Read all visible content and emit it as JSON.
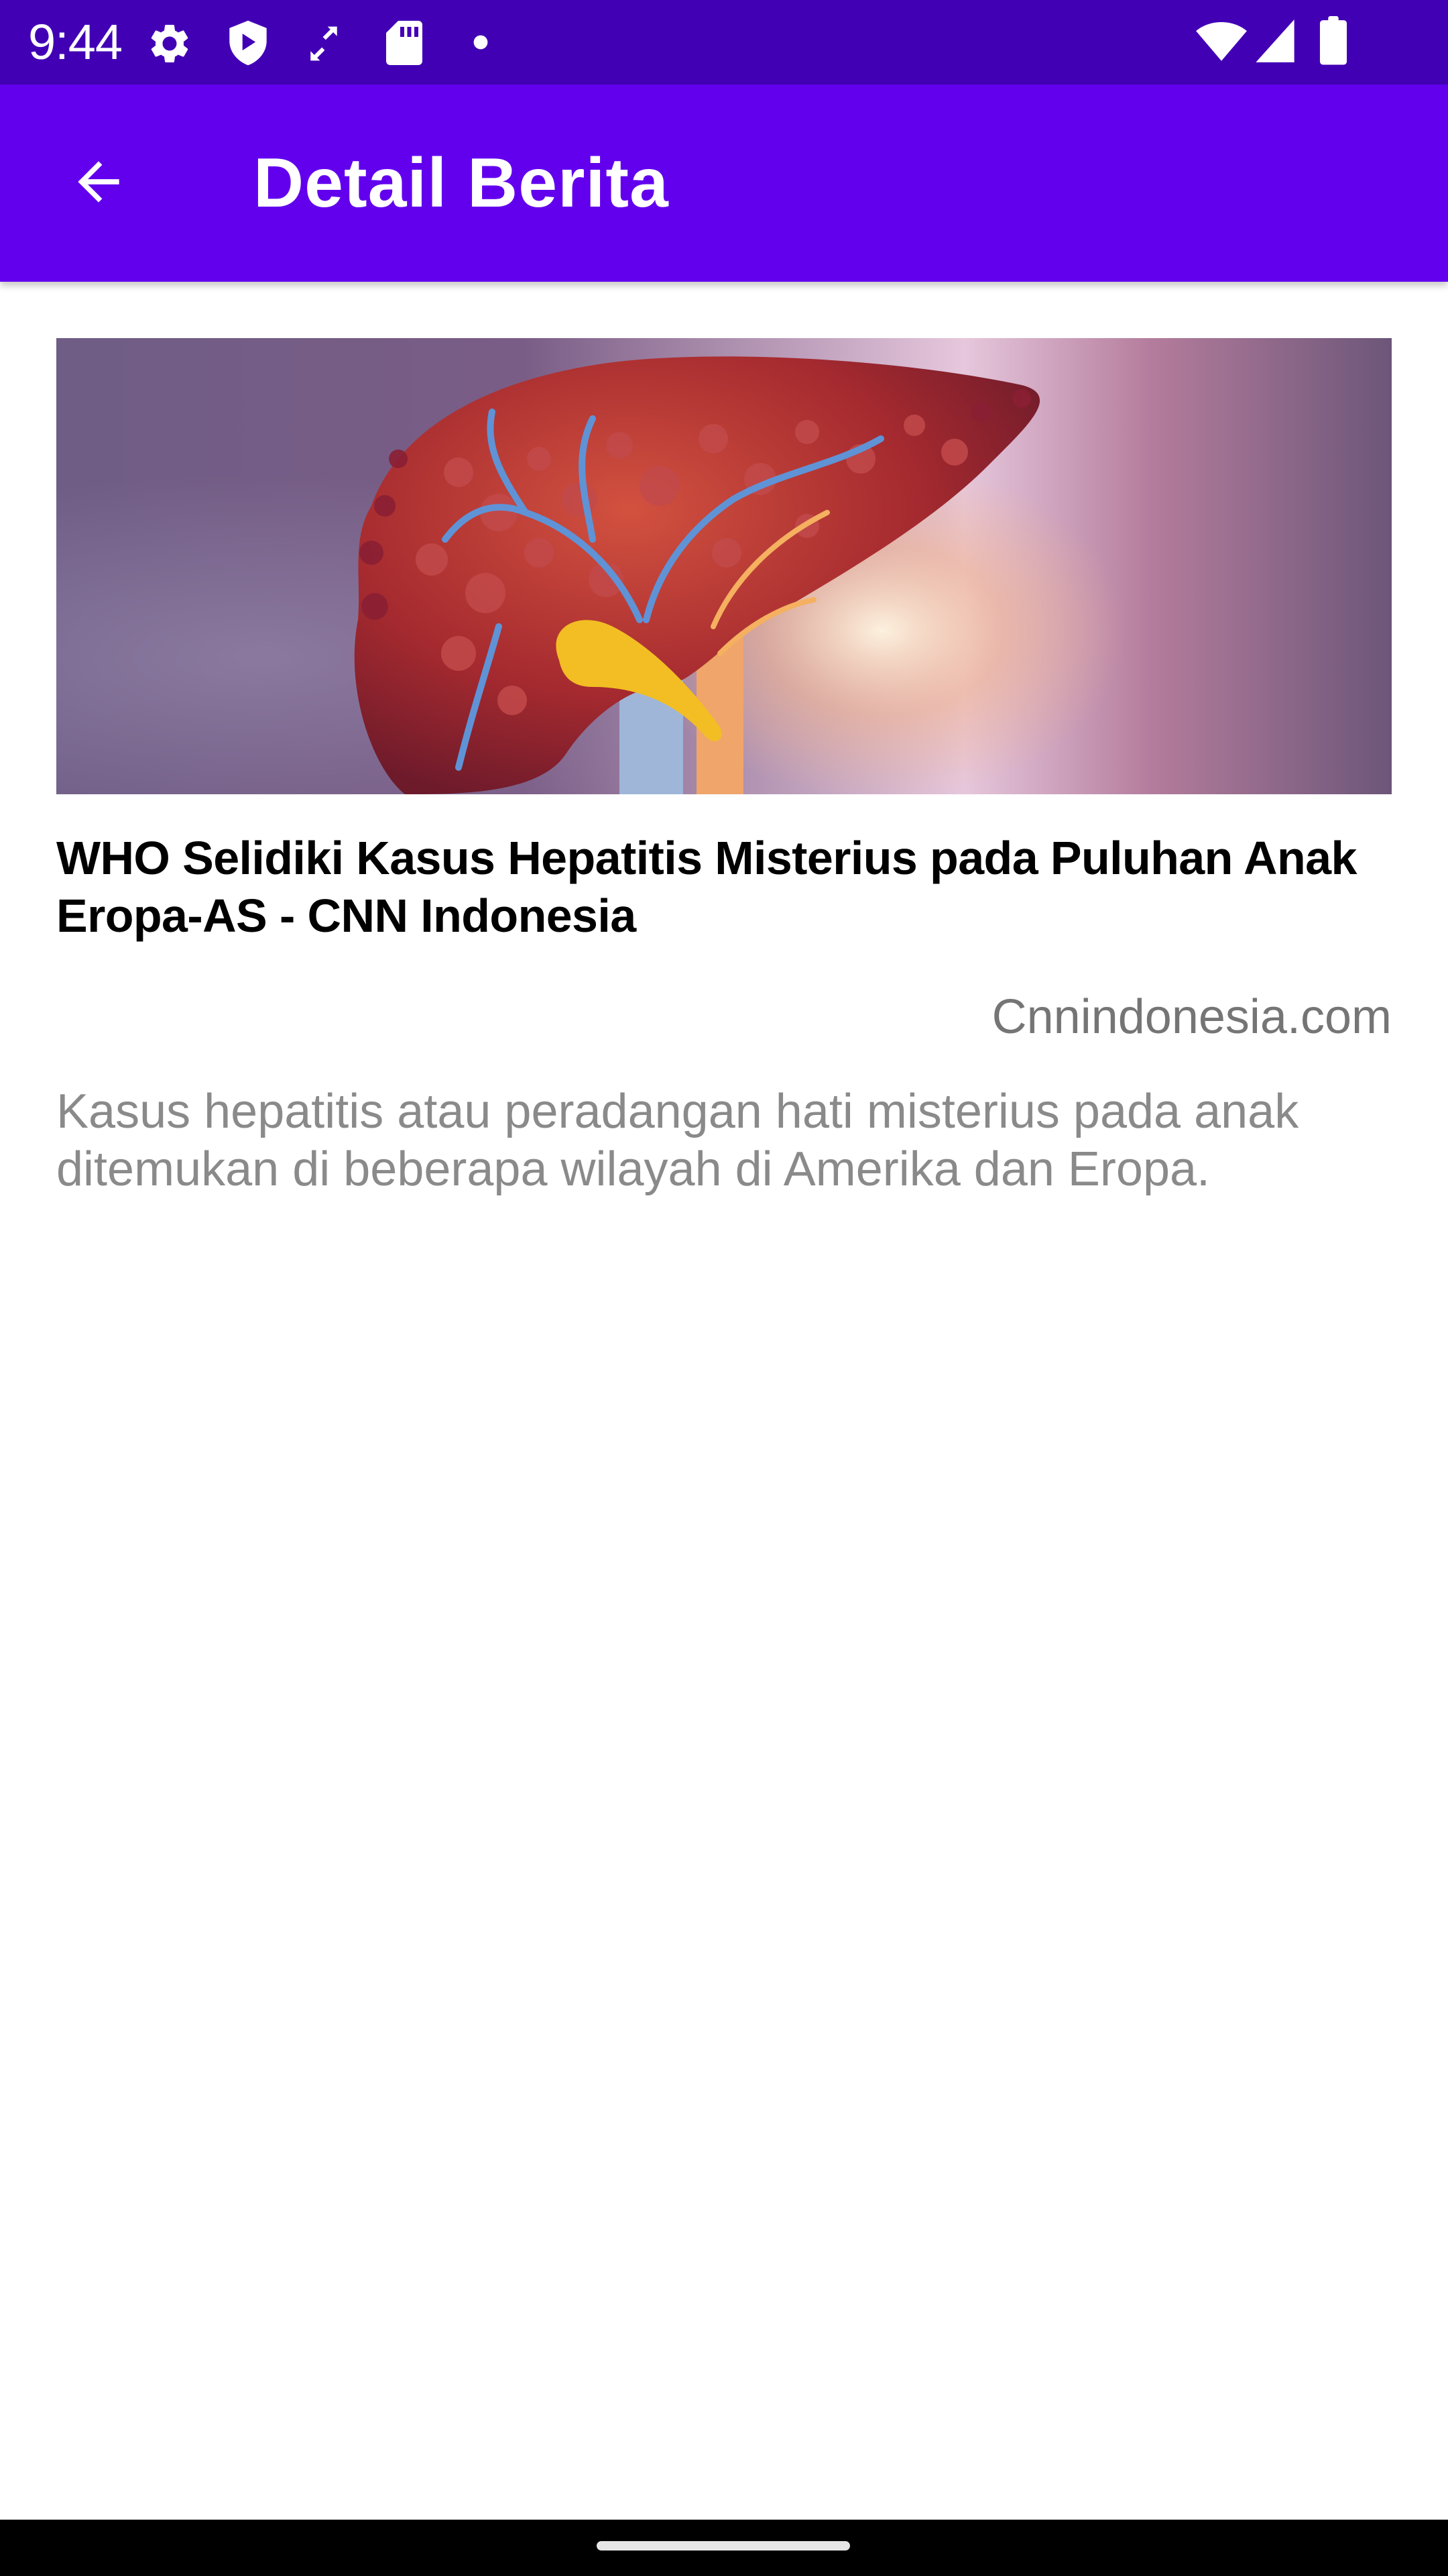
{
  "status_bar": {
    "time": "9:44",
    "icons": [
      "gear-icon",
      "shield-icon",
      "sync-off-icon",
      "sd-card-icon",
      "notification-dot-icon",
      "wifi-icon",
      "signal-icon",
      "battery-icon"
    ]
  },
  "app_bar": {
    "title": "Detail Berita",
    "back_icon": "arrow-back-icon",
    "color": "#6200ee",
    "status_color": "#4200b5"
  },
  "article": {
    "image_icon": "liver-illustration",
    "title": "WHO Selidiki Kasus Hepatitis Misterius pada Puluhan Anak Eropa-AS - CNN Indonesia",
    "source": "Cnnindonesia.com",
    "description": "Kasus hepatitis atau peradangan hati misterius pada anak ditemukan di beberapa wilayah di Amerika dan Eropa."
  }
}
